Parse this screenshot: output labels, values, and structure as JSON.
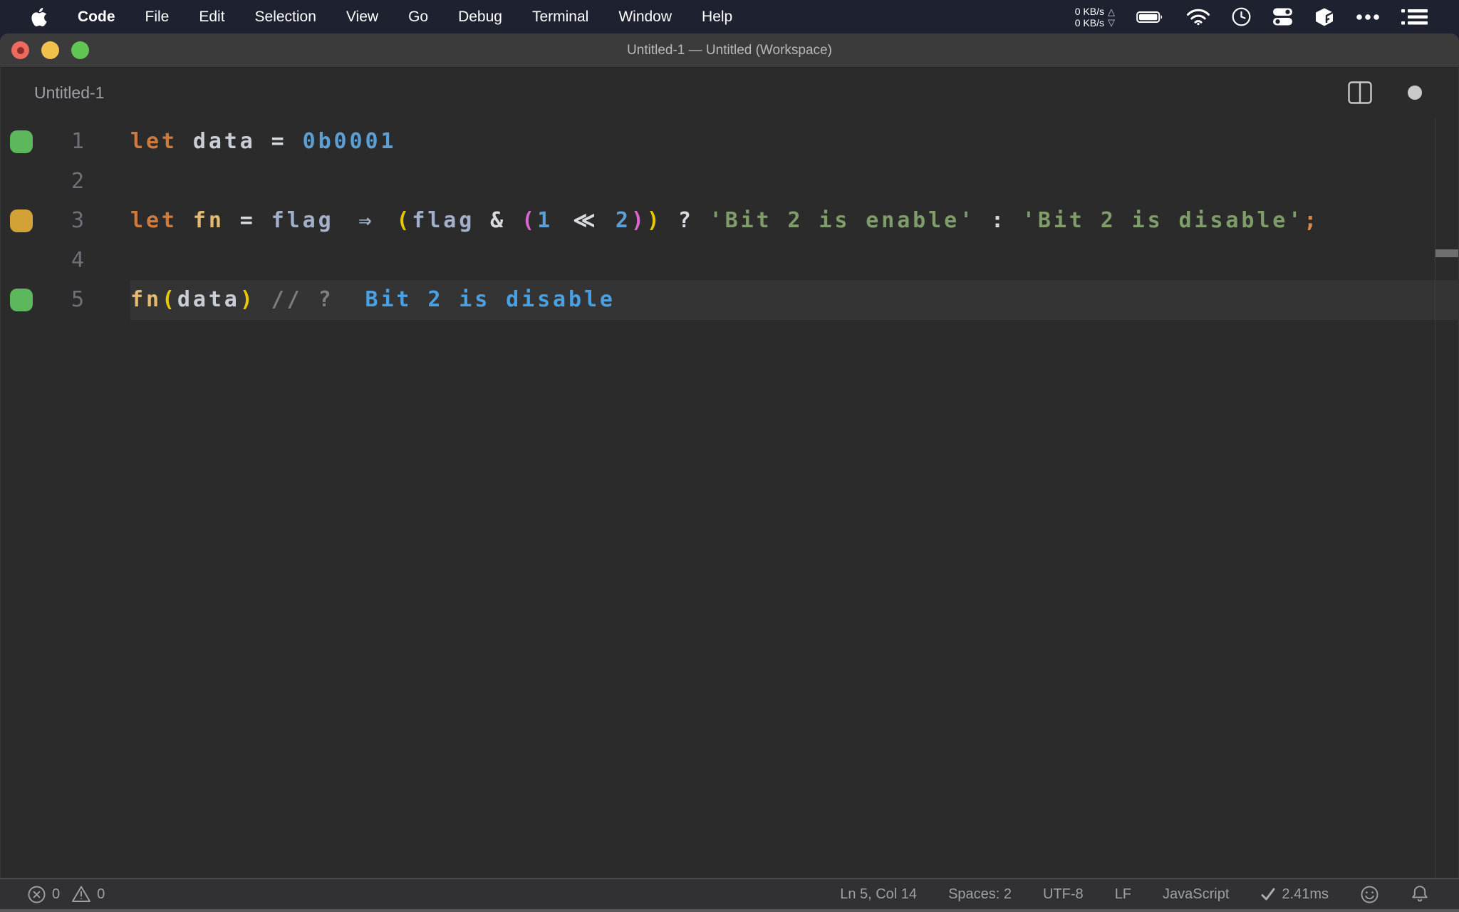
{
  "menubar": {
    "items": [
      {
        "label": "Code",
        "bold": true
      },
      {
        "label": "File"
      },
      {
        "label": "Edit"
      },
      {
        "label": "Selection"
      },
      {
        "label": "View"
      },
      {
        "label": "Go"
      },
      {
        "label": "Debug"
      },
      {
        "label": "Terminal"
      },
      {
        "label": "Window"
      },
      {
        "label": "Help"
      }
    ],
    "network": {
      "up": "0 KB/s",
      "down": "0 KB/s",
      "up_arrow": "△",
      "down_arrow": "▽"
    },
    "status_icons": [
      "battery-icon",
      "wifi-icon",
      "clock-icon",
      "toggles-icon",
      "box-icon",
      "ellipsis-icon",
      "list-icon"
    ]
  },
  "window": {
    "title": "Untitled-1 — Untitled (Workspace)"
  },
  "editor_header": {
    "tab_label": "Untitled-1"
  },
  "editor": {
    "language": "JavaScript",
    "current_line": 5,
    "lines": [
      {
        "num": "1",
        "indicator": "green",
        "tokens": [
          {
            "text": "let",
            "style": "kw"
          },
          {
            "text": " ",
            "style": "plain"
          },
          {
            "text": "data",
            "style": "var"
          },
          {
            "text": " = ",
            "style": "op"
          },
          {
            "text": "0b0001",
            "style": "num"
          }
        ]
      },
      {
        "num": "2",
        "indicator": null,
        "tokens": []
      },
      {
        "num": "3",
        "indicator": "yellow",
        "tokens": [
          {
            "text": "let",
            "style": "kw"
          },
          {
            "text": " ",
            "style": "plain"
          },
          {
            "text": "fn",
            "style": "gold"
          },
          {
            "text": " = ",
            "style": "op"
          },
          {
            "text": "flag",
            "style": "param"
          },
          {
            "text": " ",
            "style": "plain"
          },
          {
            "text": "⇒",
            "style": "param",
            "lig": true
          },
          {
            "text": " ",
            "style": "plain"
          },
          {
            "text": "(",
            "style": "py"
          },
          {
            "text": "flag",
            "style": "param"
          },
          {
            "text": " & ",
            "style": "op"
          },
          {
            "text": "(",
            "style": "pp"
          },
          {
            "text": "1",
            "style": "num"
          },
          {
            "text": " ",
            "style": "plain"
          },
          {
            "text": "≪",
            "style": "op",
            "lig": true
          },
          {
            "text": " ",
            "style": "plain"
          },
          {
            "text": "2",
            "style": "num"
          },
          {
            "text": ")",
            "style": "pp"
          },
          {
            "text": ")",
            "style": "py"
          },
          {
            "text": " ? ",
            "style": "op"
          },
          {
            "text": "'Bit 2 is enable'",
            "style": "str"
          },
          {
            "text": " : ",
            "style": "op"
          },
          {
            "text": "'Bit 2 is disable'",
            "style": "str"
          },
          {
            "text": ";",
            "style": "semi"
          }
        ]
      },
      {
        "num": "4",
        "indicator": null,
        "tokens": []
      },
      {
        "num": "5",
        "indicator": "green",
        "current": true,
        "tokens": [
          {
            "text": "fn",
            "style": "gold"
          },
          {
            "text": "(",
            "style": "py"
          },
          {
            "text": "data",
            "style": "var"
          },
          {
            "text": ")",
            "style": "py"
          },
          {
            "text": " ",
            "style": "plain"
          },
          {
            "text": "// ?",
            "style": "cm"
          },
          {
            "text": "  ",
            "style": "plain"
          },
          {
            "text": "Bit 2 is disable",
            "style": "qk"
          }
        ]
      }
    ]
  },
  "statusbar": {
    "errors": "0",
    "warnings": "0",
    "right_items": [
      "Ln 5, Col 14",
      "Spaces: 2",
      "UTF-8",
      "LF",
      "JavaScript"
    ],
    "perf": "2.41ms"
  },
  "colors": {
    "menubar_bg": "#1d2130",
    "titlebar_bg": "#3b3b3c",
    "editor_bg": "#2b2b2c",
    "statusbar_bg": "#313134",
    "indicator_green": "#5db75c",
    "indicator_yellow": "#d2a237",
    "keyword_orange": "#cd7a3e",
    "string_green": "#7e9d69",
    "number_blue": "#5b9fd3",
    "quokka_value_blue": "#47a1e4",
    "bracket_yellow": "#e9c700",
    "bracket_pink": "#da64d0"
  }
}
